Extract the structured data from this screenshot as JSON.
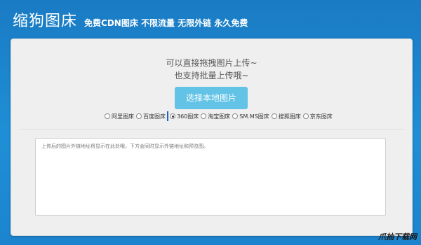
{
  "header": {
    "brand": "缩狗图床",
    "tagline": "免费CDN图床 不限流量 无限外链 永久免费"
  },
  "upload": {
    "hint_line1": "可以直接拖拽图片上传~",
    "hint_line2": "也支持批量上传哦~",
    "button_label": "选择本地图片"
  },
  "hosts": {
    "selected": "360图床",
    "items": [
      {
        "label": "阿里图床",
        "checked": false
      },
      {
        "label": "百度图床",
        "checked": false
      },
      {
        "label": "360图床",
        "checked": true
      },
      {
        "label": "淘宝图床",
        "checked": false
      },
      {
        "label": "SM.MS图床",
        "checked": false
      },
      {
        "label": "搜狐图床",
        "checked": false
      },
      {
        "label": "京东图床",
        "checked": false
      }
    ]
  },
  "result": {
    "placeholder": "上传后的图片外链地址将显示在此处哦，下方会同时显示外链地址和预览图。"
  },
  "watermark": "爪抽下载网"
}
